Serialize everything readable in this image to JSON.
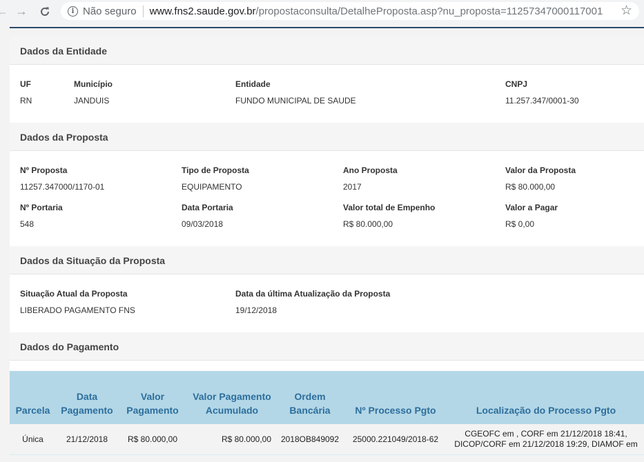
{
  "browser": {
    "back_icon": "arrow-left-icon",
    "forward_icon": "arrow-right-icon",
    "reload_icon": "reload-icon",
    "security_text": "Não seguro",
    "url_host": "www.fns2.saude.gov.br",
    "url_path": "/propostaconsulta/DetalheProposta.asp?nu_proposta=11257347000117001"
  },
  "entidade": {
    "title": "Dados da Entidade",
    "uf_label": "UF",
    "uf": "RN",
    "municipio_label": "Município",
    "municipio": "JANDUIS",
    "entidade_label": "Entidade",
    "entidade": "FUNDO MUNICIPAL DE SAUDE",
    "cnpj_label": "CNPJ",
    "cnpj": "11.257.347/0001-30"
  },
  "proposta": {
    "title": "Dados da Proposta",
    "numero_label": "Nº Proposta",
    "numero": "11257.347000/1170-01",
    "tipo_label": "Tipo de Proposta",
    "tipo": "EQUIPAMENTO",
    "ano_label": "Ano Proposta",
    "ano": "2017",
    "valor_label": "Valor da Proposta",
    "valor": "R$ 80.000,00",
    "portaria_label": "Nº Portaria",
    "portaria": "548",
    "data_portaria_label": "Data Portaria",
    "data_portaria": "09/03/2018",
    "empenho_label": "Valor total de Empenho",
    "empenho": "R$ 80.000,00",
    "a_pagar_label": "Valor a Pagar",
    "a_pagar": "R$ 0,00"
  },
  "situacao": {
    "title": "Dados da Situação da Proposta",
    "atual_label": "Situação Atual da Proposta",
    "atual": "LIBERADO PAGAMENTO FNS",
    "atualizacao_label": "Data da última Atualização da Proposta",
    "atualizacao": "19/12/2018"
  },
  "pagamento": {
    "title": "Dados do Pagamento",
    "headers": {
      "parcela": "Parcela",
      "data": "Data Pagamento",
      "valor": "Valor Pagamento",
      "acumulado": "Valor Pagamento Acumulado",
      "ordem": "Ordem Bancária",
      "processo": "Nº Processo Pgto",
      "localizacao": "Localização do Processo Pgto"
    },
    "rows": [
      {
        "parcela": "Única",
        "data": "21/12/2018",
        "valor": "R$ 80.000,00",
        "acumulado": "R$ 80.000,00",
        "ordem": "2018OB849092",
        "processo": "25000.221049/2018-62",
        "localizacao_1": "CGEOFC em , CORF em 21/12/2018 18:41,",
        "localizacao_2": "DICOP/CORF em 21/12/2018 19:29, DIAMOF em"
      }
    ]
  }
}
